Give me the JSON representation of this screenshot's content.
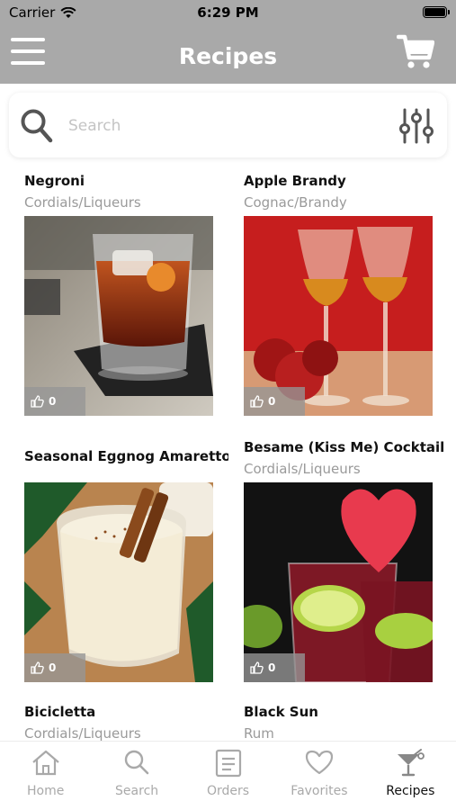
{
  "status_bar": {
    "carrier": "Carrier",
    "time": "6:29 PM"
  },
  "header": {
    "title": "Recipes",
    "menu_icon": "hamburger-menu-icon",
    "cart_icon": "shopping-cart-icon"
  },
  "search": {
    "placeholder": "Search",
    "value": "",
    "filter_icon": "sliders-filter-icon"
  },
  "recipes": [
    {
      "name": "Negroni",
      "category": "Cordials/Liqueurs",
      "likes": "0"
    },
    {
      "name": "Apple Brandy",
      "category": "Cognac/Brandy",
      "likes": "0"
    },
    {
      "name": "Seasonal Eggnog Amaretto",
      "category": "",
      "likes": "0"
    },
    {
      "name": "Besame (Kiss Me) Cocktail",
      "category": "Cordials/Liqueurs",
      "likes": "0"
    },
    {
      "name": "Bicicletta",
      "category": "Cordials/Liqueurs",
      "likes": ""
    },
    {
      "name": "Black Sun",
      "category": "Rum",
      "likes": ""
    }
  ],
  "tab_bar": {
    "tabs": [
      {
        "label": "Home",
        "icon": "home-icon",
        "active": false
      },
      {
        "label": "Search",
        "icon": "search-icon",
        "active": false
      },
      {
        "label": "Orders",
        "icon": "orders-list-icon",
        "active": false
      },
      {
        "label": "Favorites",
        "icon": "heart-icon",
        "active": false
      },
      {
        "label": "Recipes",
        "icon": "cocktail-glass-icon",
        "active": true
      }
    ]
  },
  "colors": {
    "header_bg": "#a9a9a9",
    "tab_inactive": "#a9a9a9",
    "tab_active": "#111111",
    "category_text": "#9a9a9a"
  }
}
